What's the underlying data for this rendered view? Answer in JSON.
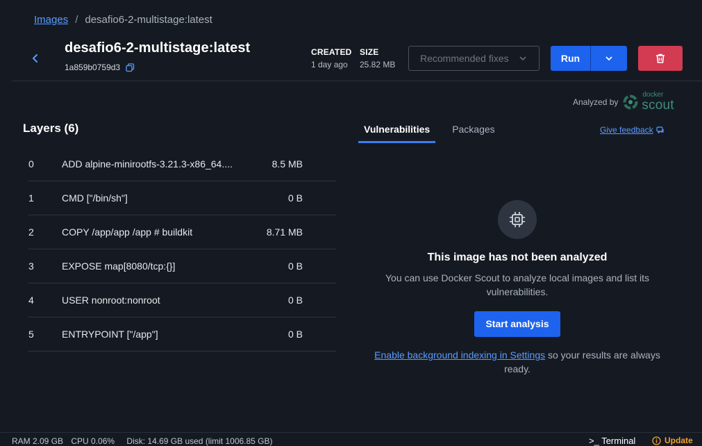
{
  "breadcrumb": {
    "root": "Images",
    "separator": "/",
    "current": "desafio6-2-multistage:latest"
  },
  "image": {
    "name": "desafio6-2-multistage:latest",
    "id": "1a859b0759d3"
  },
  "meta": {
    "created_label": "CREATED",
    "created_value": "1 day ago",
    "size_label": "SIZE",
    "size_value": "25.82 MB"
  },
  "actions": {
    "recommended_fixes": "Recommended fixes",
    "run": "Run"
  },
  "analyzed": {
    "label": "Analyzed by",
    "brand_small": "docker",
    "brand_large": "scout"
  },
  "layers": {
    "title": "Layers (6)",
    "rows": [
      {
        "index": "0",
        "command": "ADD alpine-minirootfs-3.21.3-x86_64....",
        "size": "8.5 MB"
      },
      {
        "index": "1",
        "command": "CMD [\"/bin/sh\"]",
        "size": "0 B"
      },
      {
        "index": "2",
        "command": "COPY /app/app /app # buildkit",
        "size": "8.71 MB"
      },
      {
        "index": "3",
        "command": "EXPOSE map[8080/tcp:{}]",
        "size": "0 B"
      },
      {
        "index": "4",
        "command": "USER nonroot:nonroot",
        "size": "0 B"
      },
      {
        "index": "5",
        "command": "ENTRYPOINT [\"/app\"]",
        "size": "0 B"
      }
    ]
  },
  "tabs": [
    {
      "label": "Vulnerabilities",
      "active": true
    },
    {
      "label": "Packages",
      "active": false
    }
  ],
  "feedback": "Give feedback",
  "empty_state": {
    "title": "This image has not been analyzed",
    "text": "You can use Docker Scout to analyze local images and list its vulnerabilities.",
    "button": "Start analysis",
    "link": "Enable background indexing in Settings",
    "after_link": " so your results are always ready."
  },
  "status_bar": {
    "ram": "RAM 2.09 GB",
    "cpu": "CPU 0.06%",
    "disk": "Disk: 14.69 GB used (limit 1006.85 GB)",
    "terminal": ">_ Terminal",
    "update": "Update"
  },
  "colors": {
    "accent": "#1d63ed",
    "danger": "#d33b53",
    "scout": "#3e8f79",
    "update": "#f0a030"
  }
}
